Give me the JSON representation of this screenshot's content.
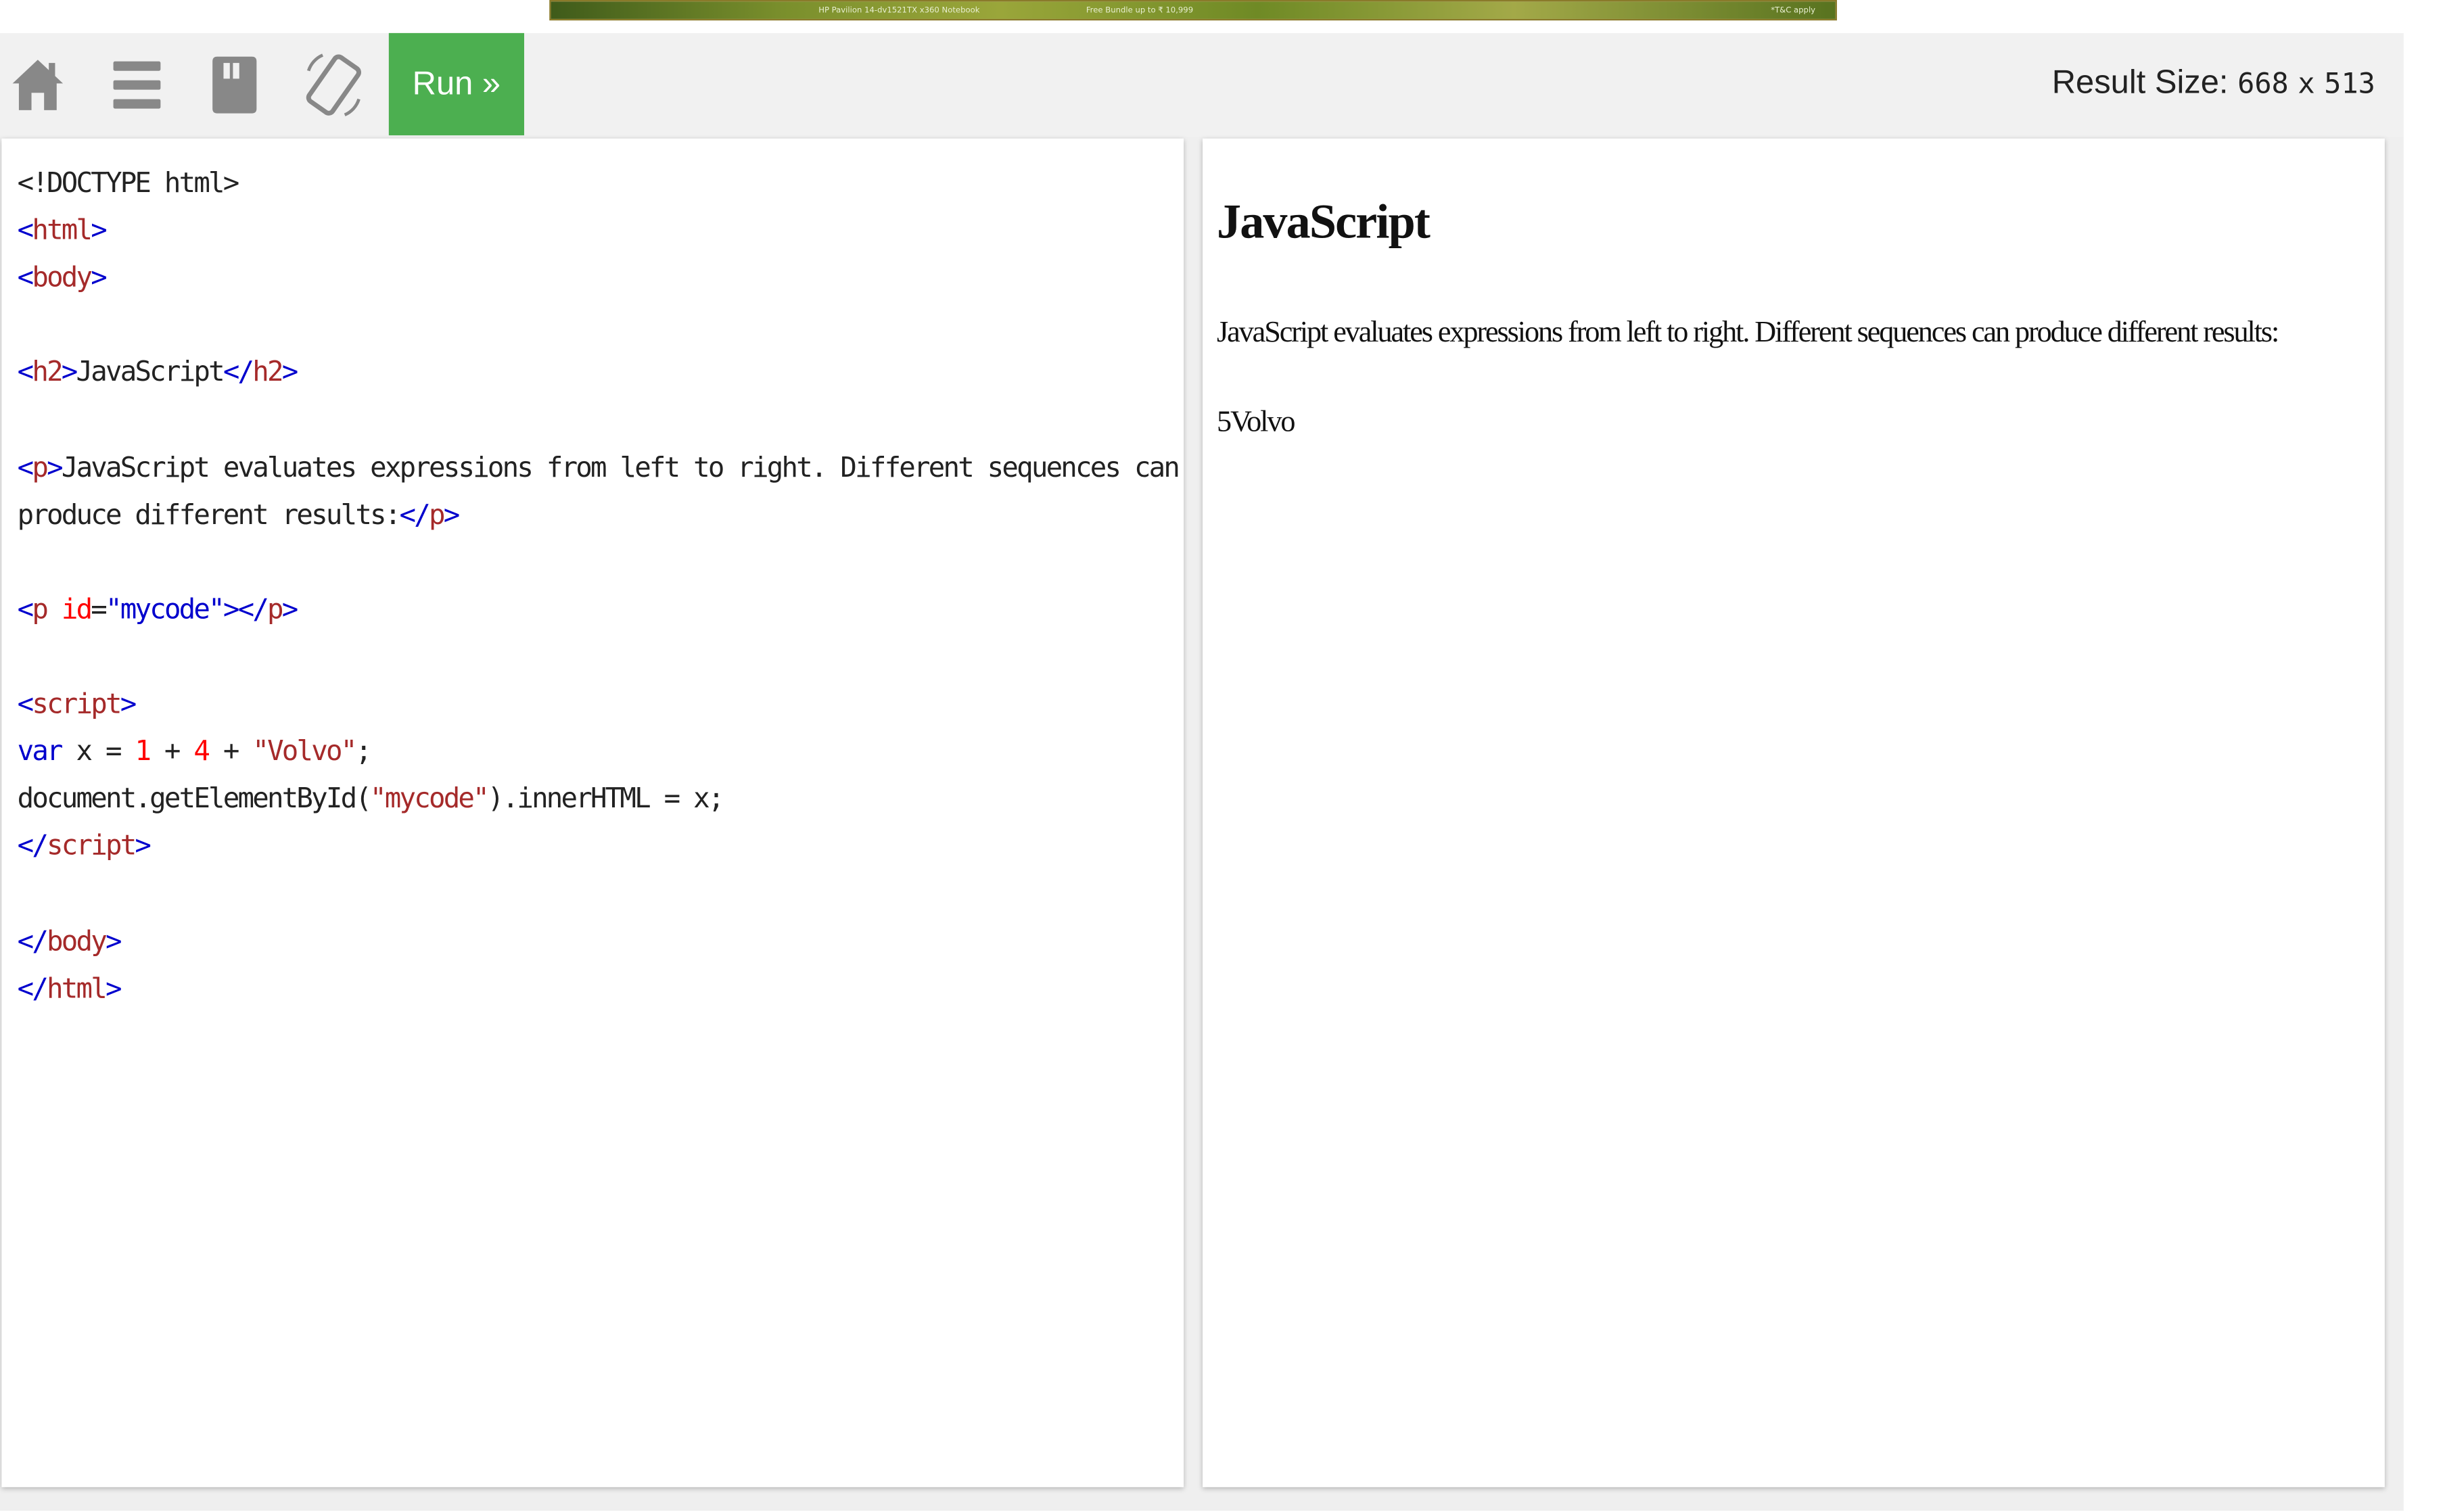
{
  "ad": {
    "text_left": "HP Pavilion 14-dv1521TX x360 Notebook",
    "text_mid": "Free Bundle up to ₹ 10,999",
    "text_right": "*T&C apply"
  },
  "toolbar": {
    "icons": [
      "home-icon",
      "menu-icon",
      "save-icon",
      "rotate-icon"
    ],
    "run_label": "Run »",
    "result_size_label": "Result Size:",
    "result_width": "668",
    "result_sep": "x",
    "result_height": "513"
  },
  "code": {
    "lines": [
      [
        {
          "t": "<!DOCTYPE html>",
          "c": "text"
        }
      ],
      [
        {
          "t": "<",
          "c": "bracket"
        },
        {
          "t": "html",
          "c": "tag"
        },
        {
          "t": ">",
          "c": "bracket"
        }
      ],
      [
        {
          "t": "<",
          "c": "bracket"
        },
        {
          "t": "body",
          "c": "tag"
        },
        {
          "t": ">",
          "c": "bracket"
        }
      ],
      [],
      [
        {
          "t": "<",
          "c": "bracket"
        },
        {
          "t": "h2",
          "c": "tag"
        },
        {
          "t": ">",
          "c": "bracket"
        },
        {
          "t": "JavaScript",
          "c": "text"
        },
        {
          "t": "</",
          "c": "bracket"
        },
        {
          "t": "h2",
          "c": "tag"
        },
        {
          "t": ">",
          "c": "bracket"
        }
      ],
      [],
      [
        {
          "t": "<",
          "c": "bracket"
        },
        {
          "t": "p",
          "c": "tag"
        },
        {
          "t": ">",
          "c": "bracket"
        },
        {
          "t": "JavaScript evaluates expressions from left to right. Different sequences can",
          "c": "text"
        }
      ],
      [
        {
          "t": "produce different results:",
          "c": "text"
        },
        {
          "t": "</",
          "c": "bracket"
        },
        {
          "t": "p",
          "c": "tag"
        },
        {
          "t": ">",
          "c": "bracket"
        }
      ],
      [],
      [
        {
          "t": "<",
          "c": "bracket"
        },
        {
          "t": "p",
          "c": "tag"
        },
        {
          "t": " ",
          "c": "text"
        },
        {
          "t": "id",
          "c": "attr"
        },
        {
          "t": "=",
          "c": "text"
        },
        {
          "t": "\"mycode\"",
          "c": "val"
        },
        {
          "t": "></",
          "c": "bracket"
        },
        {
          "t": "p",
          "c": "tag"
        },
        {
          "t": ">",
          "c": "bracket"
        }
      ],
      [],
      [
        {
          "t": "<",
          "c": "bracket"
        },
        {
          "t": "script",
          "c": "tag"
        },
        {
          "t": ">",
          "c": "bracket"
        }
      ],
      [
        {
          "t": "var",
          "c": "kw"
        },
        {
          "t": " x = ",
          "c": "text"
        },
        {
          "t": "1",
          "c": "num"
        },
        {
          "t": " + ",
          "c": "text"
        },
        {
          "t": "4",
          "c": "num"
        },
        {
          "t": " + ",
          "c": "text"
        },
        {
          "t": "\"Volvo\"",
          "c": "str"
        },
        {
          "t": ";",
          "c": "text"
        }
      ],
      [
        {
          "t": "document.getElementById(",
          "c": "text"
        },
        {
          "t": "\"mycode\"",
          "c": "str"
        },
        {
          "t": ").innerHTML = x;",
          "c": "text"
        }
      ],
      [
        {
          "t": "</",
          "c": "bracket"
        },
        {
          "t": "script",
          "c": "tag"
        },
        {
          "t": ">",
          "c": "bracket"
        }
      ],
      [],
      [
        {
          "t": "</",
          "c": "bracket"
        },
        {
          "t": "body",
          "c": "tag"
        },
        {
          "t": ">",
          "c": "bracket"
        }
      ],
      [
        {
          "t": "</",
          "c": "bracket"
        },
        {
          "t": "html",
          "c": "tag"
        },
        {
          "t": ">",
          "c": "bracket"
        }
      ]
    ]
  },
  "result": {
    "heading": "JavaScript",
    "paragraph": "JavaScript evaluates expressions from left to right. Different sequences can produce different results:",
    "output": "5Volvo"
  },
  "colors": {
    "run_button": "#4caf50",
    "toolbar_bg": "#f1f1f1",
    "tag": "#a52a2a",
    "bracket": "#0000cd",
    "attr": "#ff0000",
    "number": "#ff0000",
    "string": "#a52a2a",
    "keyword": "#0000cd"
  }
}
